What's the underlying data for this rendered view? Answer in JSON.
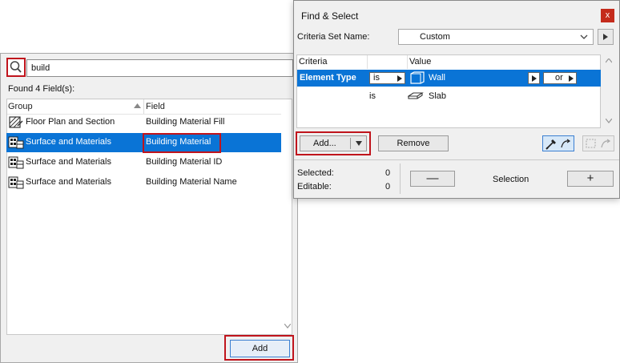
{
  "search": {
    "value": "build",
    "found_label": "Found 4 Field(s):"
  },
  "list": {
    "columns": {
      "group": "Group",
      "field": "Field"
    },
    "rows": [
      {
        "icon": "floor-plan-icon",
        "group": "Floor Plan and Section",
        "field": "Building Material Fill",
        "selected": false
      },
      {
        "icon": "surface-materials-icon",
        "group": "Surface and Materials",
        "field": "Building Material",
        "selected": true
      },
      {
        "icon": "surface-materials-icon",
        "group": "Surface and Materials",
        "field": "Building Material ID",
        "selected": false
      },
      {
        "icon": "surface-materials-icon",
        "group": "Surface and Materials",
        "field": "Building Material Name",
        "selected": false
      }
    ],
    "add_label": "Add"
  },
  "dialog": {
    "title": "Find & Select",
    "close_label": "x",
    "criteria_set_label": "Criteria Set Name:",
    "criteria_set_value": "Custom",
    "table": {
      "col_criteria": "Criteria",
      "col_value": "Value",
      "rows": [
        {
          "criteria": "Element Type",
          "operator": "is",
          "value": "Wall",
          "connector": "or"
        },
        {
          "criteria": "",
          "operator": "is",
          "value": "Slab"
        }
      ]
    },
    "add_label": "Add...",
    "remove_label": "Remove",
    "selected_label": "Selected:",
    "selected_value": "0",
    "editable_label": "Editable:",
    "editable_value": "0",
    "minus_label": "—",
    "selection_label": "Selection",
    "plus_label": "+"
  },
  "colors": {
    "selection_blue": "#0a74d6",
    "highlight_red": "#c0141c",
    "close_red": "#c42b1c"
  }
}
